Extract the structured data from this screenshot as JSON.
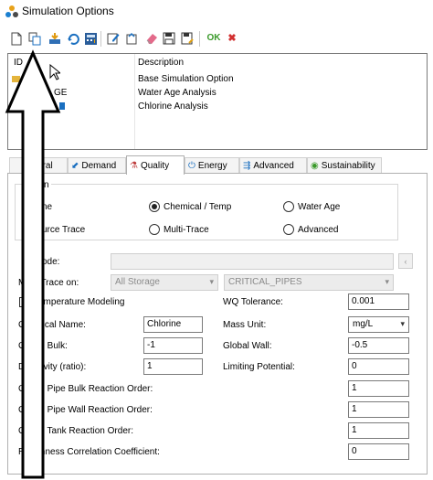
{
  "window": {
    "title": "Simulation Options"
  },
  "toolbar": {
    "ok_label": "OK",
    "cancel_symbol": "✖"
  },
  "list": {
    "columns": [
      "ID",
      "Description"
    ],
    "rows": [
      {
        "id": "",
        "description": "Base Simulation Option"
      },
      {
        "id": "GE",
        "description": "Water Age Analysis"
      },
      {
        "id": "",
        "description": "Chlorine Analysis"
      }
    ]
  },
  "tabs": [
    {
      "label": "eral",
      "icon": "general-icon"
    },
    {
      "label": "Demand",
      "icon": "demand-icon"
    },
    {
      "label": "Quality",
      "icon": "quality-icon"
    },
    {
      "label": "Energy",
      "icon": "energy-icon"
    },
    {
      "label": "Advanced",
      "icon": "advanced-icon"
    },
    {
      "label": "Sustainability",
      "icon": "sustainability-icon"
    }
  ],
  "quality": {
    "group_title": "n",
    "radios": {
      "none": "ne",
      "chemical_temp": "Chemical / Temp",
      "water_age": "Water Age",
      "source_trace": "urce Trace",
      "multi_trace": "Multi-Trace",
      "advanced": "Advanced"
    },
    "trace_node_label": "ode:",
    "multi_trace_label": "Multi-Trace on:",
    "multi_trace_value1": "All Storage",
    "multi_trace_value2": "CRITICAL_PIPES",
    "temperature_modeling_label": "Temperature Modeling",
    "wq_tolerance_label": "WQ Tolerance:",
    "wq_tolerance_value": "0.001",
    "chemical_name_label": "Chemical Name:",
    "chemical_name_value": "Chlorine",
    "mass_unit_label": "Mass Unit:",
    "mass_unit_value": "mg/L",
    "global_bulk_label": "Global Bulk:",
    "global_bulk_value": "-1",
    "global_wall_label": "Global Wall:",
    "global_wall_value": "-0.5",
    "diffusivity_label": "Diffusivity (ratio):",
    "diffusivity_value": "1",
    "limiting_potential_label": "Limiting Potential:",
    "limiting_potential_value": "0",
    "pipe_bulk_order_label": "Global Pipe Bulk Reaction Order:",
    "pipe_bulk_order_value": "1",
    "pipe_wall_order_label": "Global Pipe Wall Reaction Order:",
    "pipe_wall_order_value": "1",
    "tank_order_label": "Global Tank Reaction Order:",
    "tank_order_value": "1",
    "roughness_coeff_label": "Roughness Correlation Coefficient:",
    "roughness_coeff_value": "0"
  },
  "colors": {
    "ok_green": "#3a9a2a",
    "cancel_red": "#d23030",
    "active_tab_border": "#b0b0b0"
  }
}
